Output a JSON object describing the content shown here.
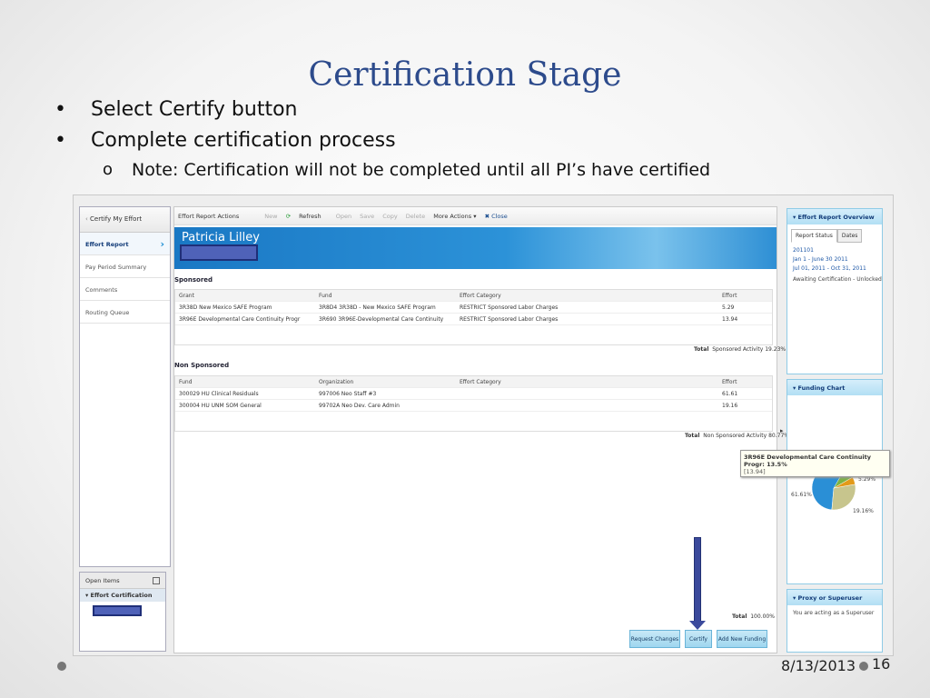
{
  "slide": {
    "title": "Certification Stage",
    "bullets": [
      {
        "dot": "•",
        "text": "Select Certify button"
      },
      {
        "dot": "•",
        "text": "Complete certification process"
      }
    ],
    "sub_bullet": {
      "dot": "o",
      "text": "Note: Certification will not be completed until all PI’s  have certified"
    },
    "date": "8/13/2013",
    "page_number": "16"
  },
  "app": {
    "left_nav": {
      "header": "Certify My Effort",
      "items": [
        "Effort Report",
        "Pay Period Summary",
        "Comments",
        "Routing Queue"
      ],
      "selected_arrow": "›"
    },
    "open_items": {
      "header": "Open Items",
      "sub": "▾ Effort Certification"
    },
    "toolbar": {
      "label": "Effort Report Actions",
      "buttons": [
        "New",
        "Refresh",
        "Open",
        "Save",
        "Copy",
        "Delete",
        "More Actions ▾",
        "✖ Close"
      ]
    },
    "banner_name": "Patricia Lilley",
    "sponsored": {
      "title": "Sponsored",
      "headers": [
        "Grant",
        "Fund",
        "Effort Category",
        "Effort"
      ],
      "rows": [
        [
          "3R38D New Mexico SAFE Program",
          "3R8D4 3R38D - New Mexico SAFE Program",
          "RESTRICT Sponsored Labor Charges",
          "5.29"
        ],
        [
          "3R96E Developmental Care Continuity Progr",
          "3R690 3R96E-Developmental Care Continuity",
          "RESTRICT Sponsored Labor Charges",
          "13.94"
        ]
      ],
      "total_label": "Total",
      "total_value": "Sponsored Activity 19.23%"
    },
    "non_sponsored": {
      "title": "Non Sponsored",
      "headers": [
        "Fund",
        "Organization",
        "Effort Category",
        "Effort"
      ],
      "rows": [
        [
          "300029 HU Clinical Residuals",
          "997006 Neo Staff #3",
          "",
          "61.61"
        ],
        [
          "300004 HU UNM SOM General",
          "99702A Neo Dev. Care Admin",
          "",
          "19.16"
        ]
      ],
      "total_label": "Total",
      "total_value": "Non Sponsored Activity 80.77%"
    },
    "grand_total": {
      "label": "Total",
      "value": "100.00%"
    },
    "buttons": {
      "request_changes": "Request Changes",
      "certify": "Certify",
      "add_funding": "Add New Funding"
    },
    "overview": {
      "header": "▾ Effort Report Overview",
      "tabs": [
        "Report Status",
        "Dates"
      ],
      "lines": [
        "201101",
        "Jan 1 - June 30 2011",
        "Jul 01, 2011 - Oct 31, 2011",
        "Awaiting Certification - Unlocked"
      ]
    },
    "funding_chart": {
      "header": "▾ Funding Chart",
      "tooltip_title": "3R96E Developmental Care Continuity Progr:  13.5%",
      "tooltip_value": "[13.94]",
      "labels": [
        "5.29%",
        "61.61%",
        "19.16%"
      ],
      "colors": {
        "blue": "#2a8fd6",
        "olive": "#c7c58d",
        "orange": "#e29a1a",
        "green": "#7cb342"
      }
    },
    "proxy": {
      "header": "▾ Proxy or Superuser",
      "text": "You are acting as a Superuser"
    }
  }
}
